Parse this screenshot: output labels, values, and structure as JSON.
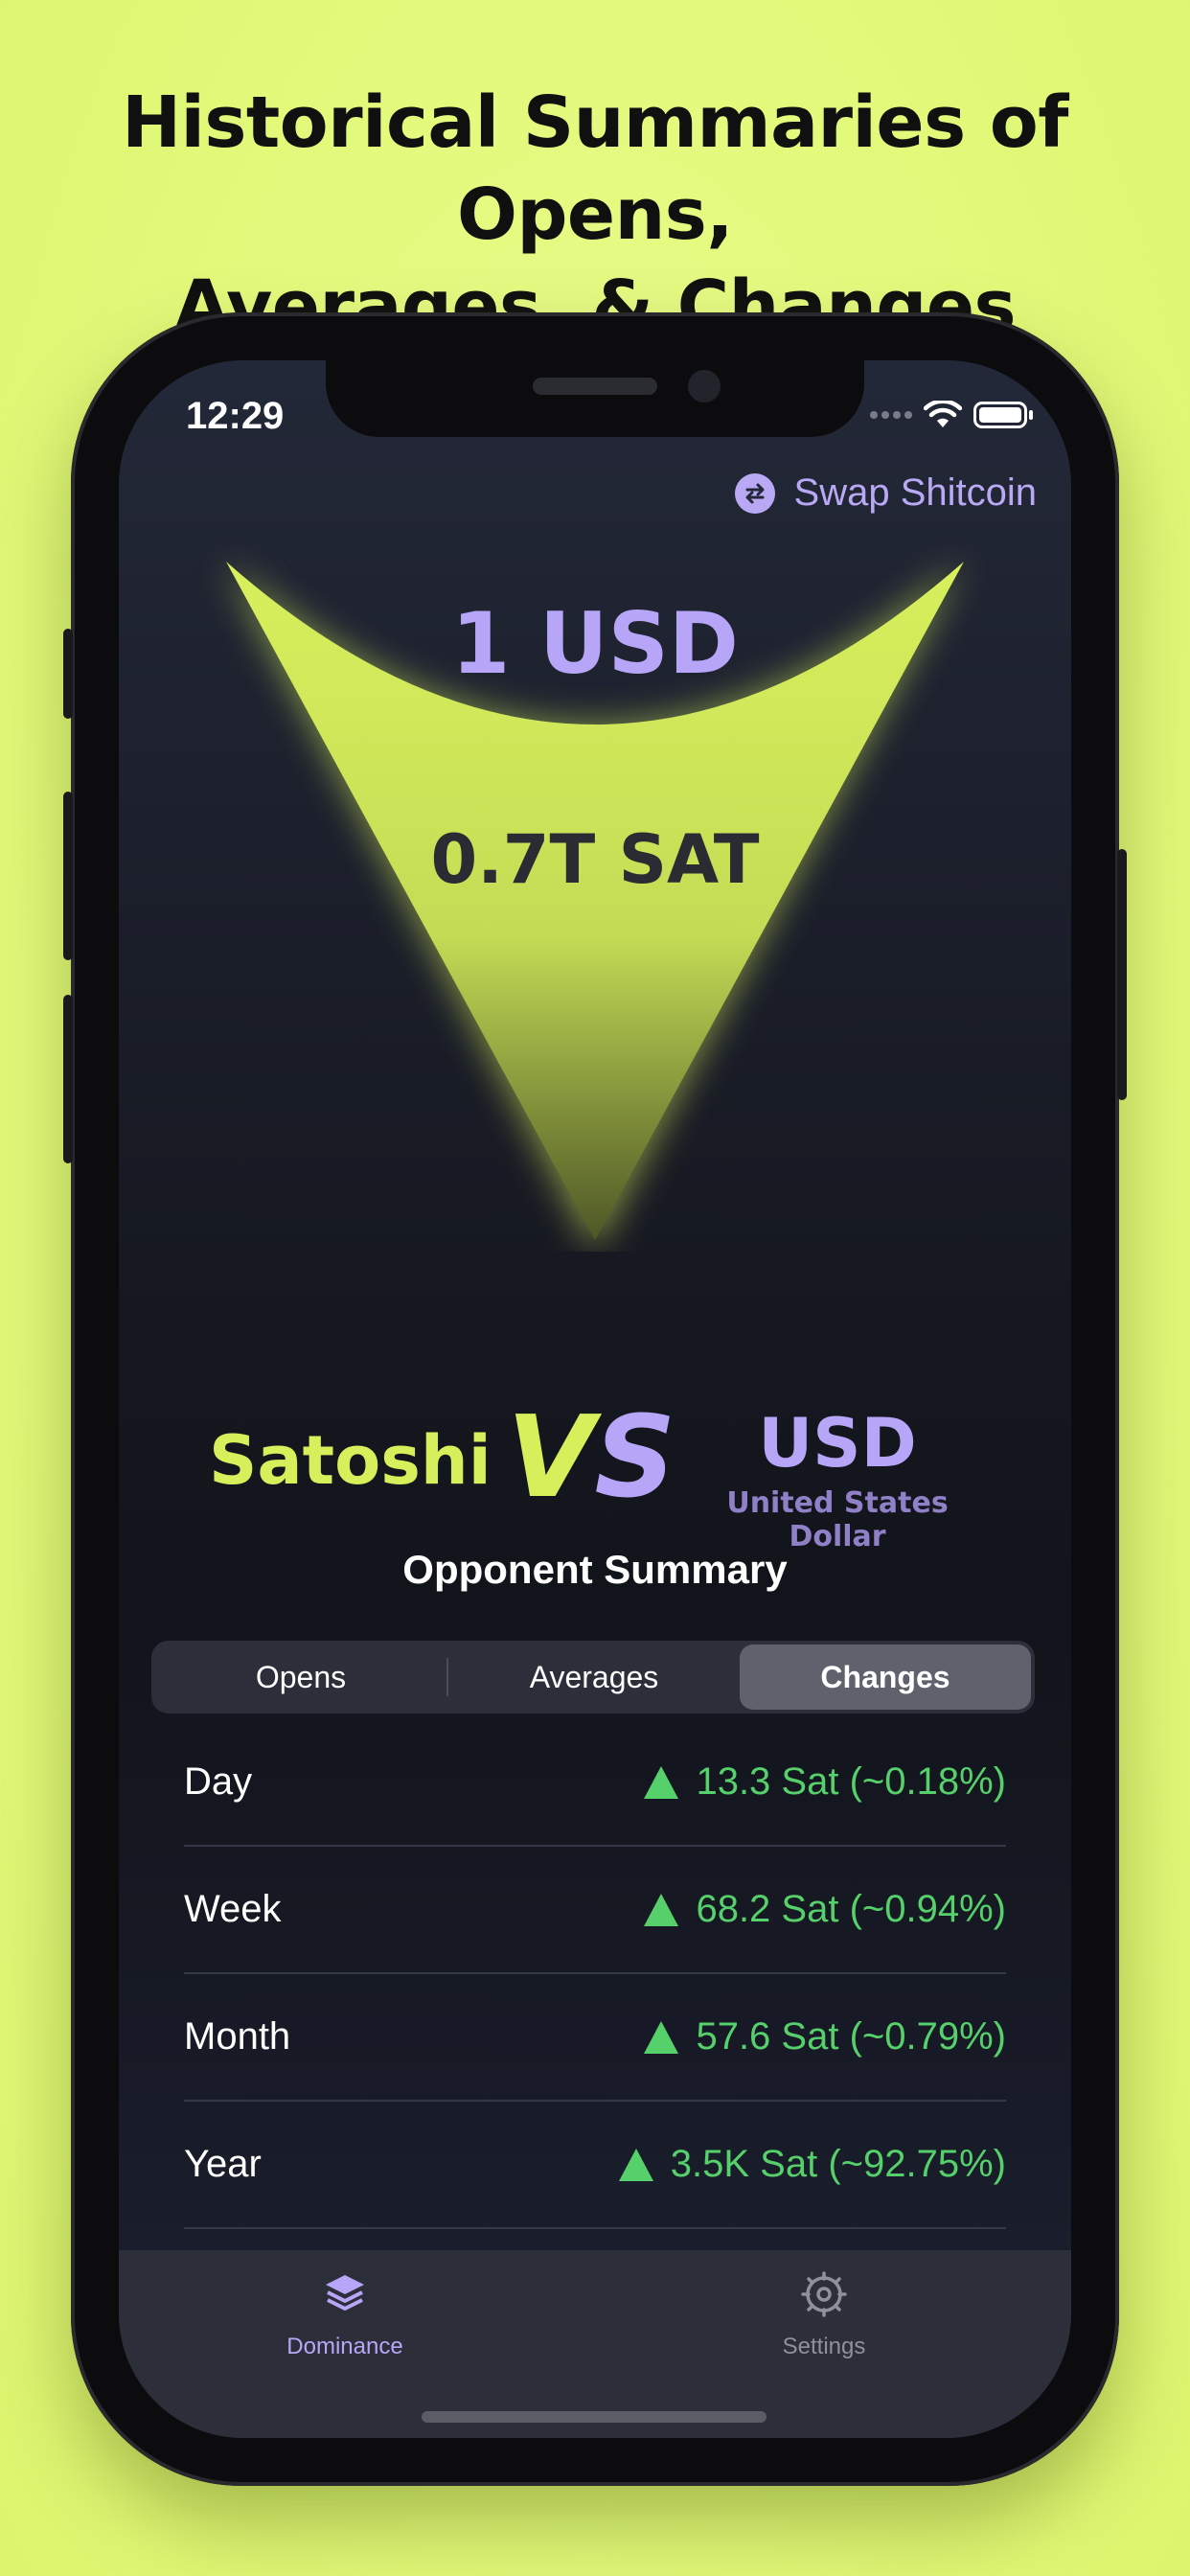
{
  "headline": {
    "line1": "Historical Summaries of Opens,",
    "line2": "Averages, & Changes"
  },
  "status_bar": {
    "time": "12:29"
  },
  "swap_button": {
    "label": "Swap Shitcoin",
    "icon": "swap-arrows-icon"
  },
  "hero": {
    "top_amount": "1 USD",
    "bottom_amount": "0.7T SAT"
  },
  "versus": {
    "left_name": "Satoshi",
    "vs_v": "V",
    "vs_s": "S",
    "right_code": "USD",
    "right_name": "United States Dollar"
  },
  "summary": {
    "title": "Opponent Summary",
    "tabs": [
      {
        "label": "Opens",
        "active": false
      },
      {
        "label": "Averages",
        "active": false
      },
      {
        "label": "Changes",
        "active": true
      }
    ],
    "rows": [
      {
        "label": "Day",
        "value": "13.3 Sat (~0.18%)",
        "direction": "up"
      },
      {
        "label": "Week",
        "value": "68.2 Sat (~0.94%)",
        "direction": "up"
      },
      {
        "label": "Month",
        "value": "57.6 Sat (~0.79%)",
        "direction": "up"
      },
      {
        "label": "Year",
        "value": "3.5K Sat (~92.75%)",
        "direction": "up"
      }
    ]
  },
  "tab_bar": {
    "items": [
      {
        "label": "Dominance",
        "icon": "stack-layers-icon",
        "active": true
      },
      {
        "label": "Settings",
        "icon": "gear-icon",
        "active": false
      }
    ]
  },
  "colors": {
    "background": "#e3fa7d",
    "accent_lime": "#d7ef5a",
    "accent_purple": "#b7a6f7",
    "positive_green": "#55d06a",
    "tabbar_bg": "#2c2f3a"
  }
}
